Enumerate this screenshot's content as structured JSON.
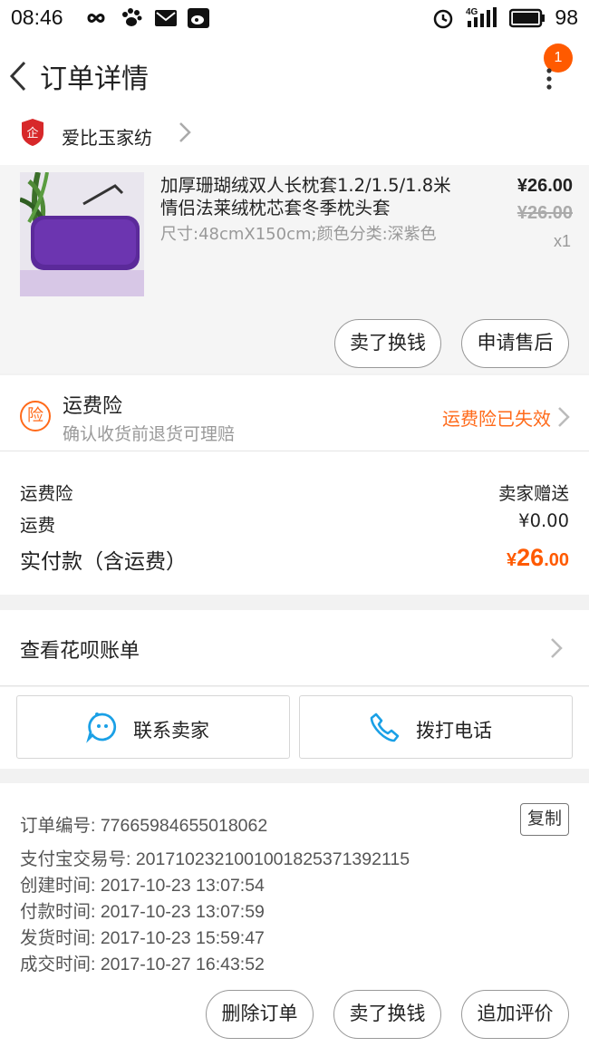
{
  "status_bar": {
    "time": "08:46",
    "network": "4G",
    "battery": "98"
  },
  "header": {
    "title": "订单详情",
    "badge_count": "1"
  },
  "shop": {
    "name": "爱比玉家纺",
    "shop_icon_text": "企"
  },
  "product": {
    "title": "加厚珊瑚绒双人长枕套1.2/1.5/1.8米情侣法莱绒枕芯套冬季枕头套",
    "sku": "尺寸:48cmX150cm;颜色分类:深紫色",
    "price": "¥26.00",
    "original_price": "¥26.00",
    "quantity": "x1",
    "action_sell": "卖了换钱",
    "action_aftersale": "申请售后"
  },
  "insurance": {
    "icon_text": "险",
    "title": "运费险",
    "subtitle": "确认收货前退货可理赔",
    "status": "运费险已失效"
  },
  "fees": {
    "insurance_label": "运费险",
    "insurance_value": "卖家赠送",
    "shipping_label": "运费",
    "shipping_value": "¥0.00",
    "total_label": "实付款（含运费）",
    "total_currency": "¥",
    "total_integer": "26",
    "total_decimal": ".00"
  },
  "huabei": {
    "label": "查看花呗账单"
  },
  "contact": {
    "seller": "联系卖家",
    "phone": "拨打电话"
  },
  "order_info": {
    "order_no": "订单编号: 77665984655018062",
    "copy": "复制",
    "alipay_no": "支付宝交易号: 2017102321001001825371392115",
    "created": "创建时间: 2017-10-23 13:07:54",
    "paid": "付款时间: 2017-10-23 13:07:59",
    "shipped": "发货时间: 2017-10-23 15:59:47",
    "completed": "成交时间: 2017-10-27 16:43:52"
  },
  "bottom_actions": {
    "delete": "删除订单",
    "sell": "卖了换钱",
    "review": "追加评价"
  },
  "colors": {
    "accent": "#ff5a00",
    "badge": "#ff5a00",
    "contact_icon": "#1aa0e6"
  }
}
